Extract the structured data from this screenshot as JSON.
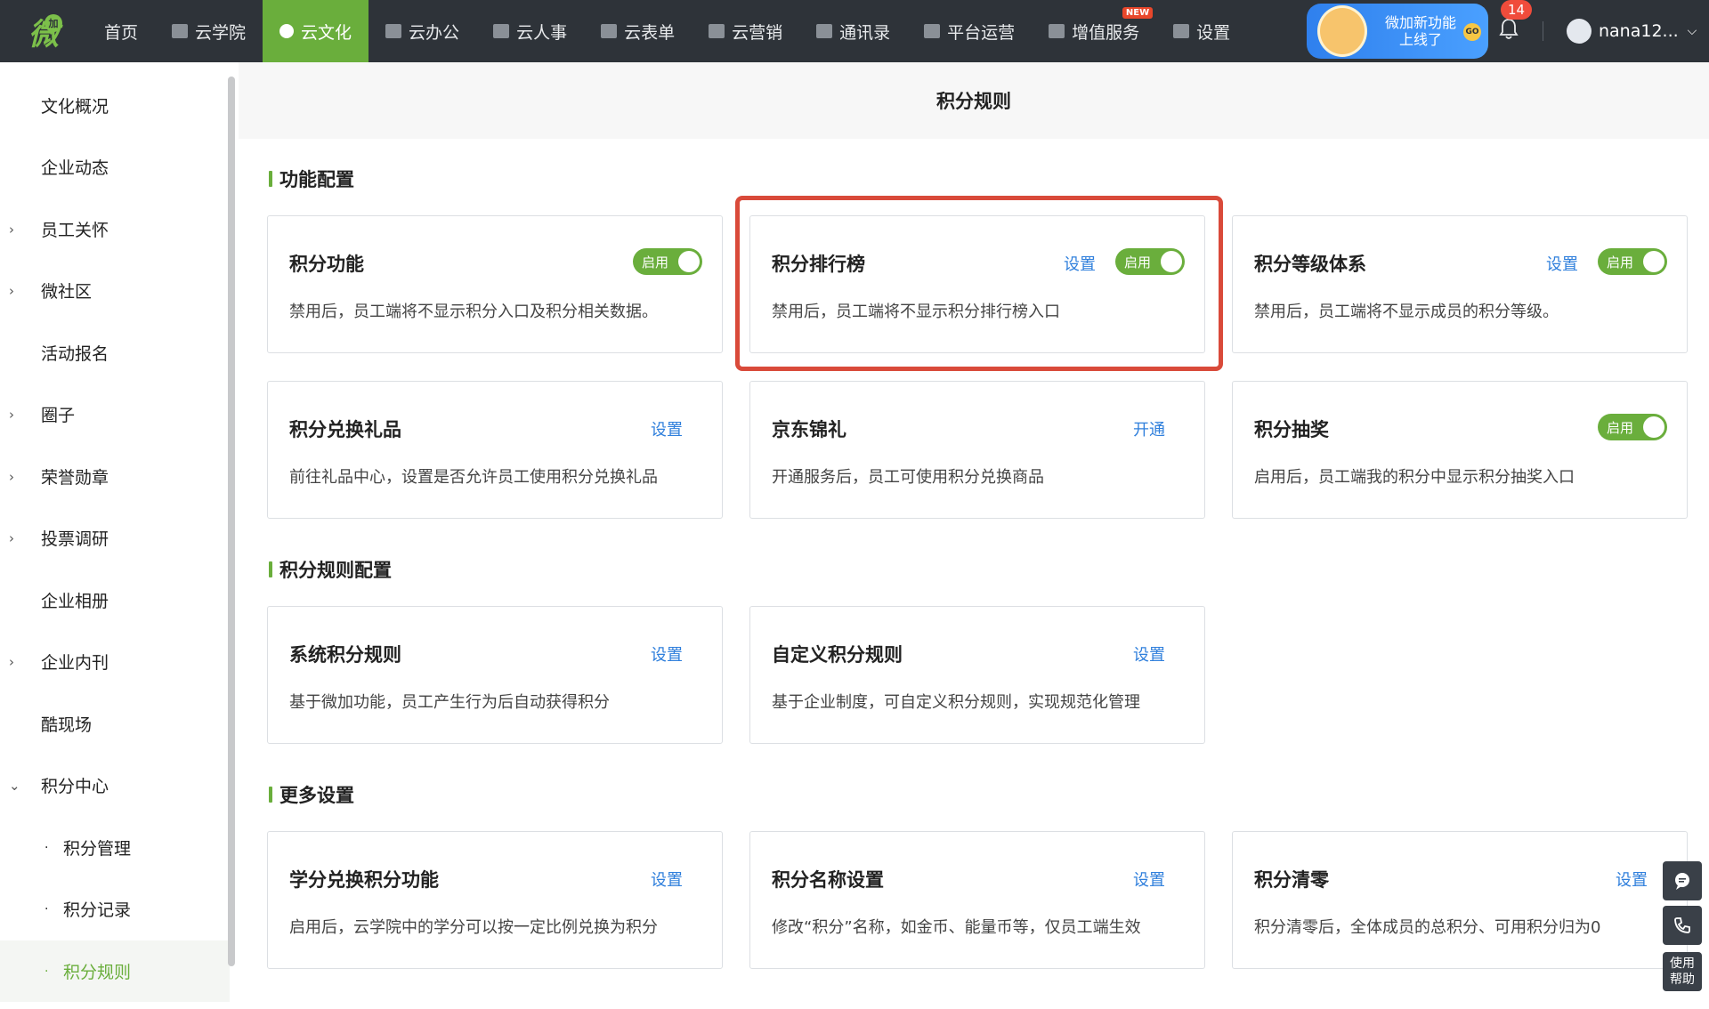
{
  "nav": {
    "logo_text": "微",
    "logo_badge": "加",
    "items": [
      {
        "label": "首页",
        "icon": "none"
      },
      {
        "label": "云学院",
        "icon": "edit-icon"
      },
      {
        "label": "云文化",
        "icon": "gear-flower-icon",
        "active": true
      },
      {
        "label": "云办公",
        "icon": "briefcase-icon"
      },
      {
        "label": "云人事",
        "icon": "id-card-icon"
      },
      {
        "label": "云表单",
        "icon": "form-icon"
      },
      {
        "label": "云营销",
        "icon": "chart-icon"
      },
      {
        "label": "通讯录",
        "icon": "contact-icon"
      },
      {
        "label": "平台运营",
        "icon": "shield-icon"
      },
      {
        "label": "增值服务",
        "icon": "diamond-icon",
        "badge": "NEW"
      },
      {
        "label": "设置",
        "icon": "grid-icon"
      }
    ],
    "promo_line1": "微加新功能",
    "promo_line2": "上线了",
    "promo_go": "GO",
    "bell_count": "14",
    "user_name": "nana12...",
    "accent": "#6aae3c"
  },
  "sidebar": {
    "items": [
      {
        "label": "文化概况",
        "arrow": ""
      },
      {
        "label": "企业动态",
        "arrow": ""
      },
      {
        "label": "员工关怀",
        "arrow": "›"
      },
      {
        "label": "微社区",
        "arrow": "›"
      },
      {
        "label": "活动报名",
        "arrow": ""
      },
      {
        "label": "圈子",
        "arrow": "›"
      },
      {
        "label": "荣誉勋章",
        "arrow": "›"
      },
      {
        "label": "投票调研",
        "arrow": "›"
      },
      {
        "label": "企业相册",
        "arrow": ""
      },
      {
        "label": "企业内刊",
        "arrow": "›"
      },
      {
        "label": "酷现场",
        "arrow": ""
      },
      {
        "label": "积分中心",
        "arrow": "⌄"
      },
      {
        "label": "积分管理",
        "sub": true
      },
      {
        "label": "积分记录",
        "sub": true
      },
      {
        "label": "积分规则",
        "sub": true,
        "active": true
      }
    ]
  },
  "main": {
    "page_title": "积分规则",
    "sections": {
      "feature": "功能配置",
      "rules": "积分规则配置",
      "more": "更多设置"
    },
    "toggle_label": "启用",
    "cards": {
      "points_feature": {
        "title": "积分功能",
        "desc": "禁用后，员工端将不显示积分入口及积分相关数据。"
      },
      "ranking": {
        "title": "积分排行榜",
        "link": "设置",
        "desc": "禁用后，员工端将不显示积分排行榜入口"
      },
      "level": {
        "title": "积分等级体系",
        "link": "设置",
        "desc": "禁用后，员工端将不显示成员的积分等级。"
      },
      "gift": {
        "title": "积分兑换礼品",
        "link": "设置",
        "desc": "前往礼品中心，设置是否允许员工使用积分兑换礼品"
      },
      "jd": {
        "title": "京东锦礼",
        "link": "开通",
        "desc": "开通服务后，员工可使用积分兑换商品"
      },
      "lottery": {
        "title": "积分抽奖",
        "desc": "启用后，员工端我的积分中显示积分抽奖入口"
      },
      "system_rules": {
        "title": "系统积分规则",
        "link": "设置",
        "desc": "基于微加功能，员工产生行为后自动获得积分"
      },
      "custom_rules": {
        "title": "自定义积分规则",
        "link": "设置",
        "desc": "基于企业制度，可自定义积分规则，实现规范化管理"
      },
      "credit_exchange": {
        "title": "学分兑换积分功能",
        "link": "设置",
        "desc": "启用后，云学院中的学分可以按一定比例兑换为积分"
      },
      "name_setting": {
        "title": "积分名称设置",
        "link": "设置",
        "desc": "修改“积分”名称，如金币、能量币等，仅员工端生效"
      },
      "clear": {
        "title": "积分清零",
        "link": "设置",
        "desc": "积分清零后，全体成员的总积分、可用积分归为0"
      }
    }
  },
  "float": {
    "help_line1": "使用",
    "help_line2": "帮助"
  }
}
